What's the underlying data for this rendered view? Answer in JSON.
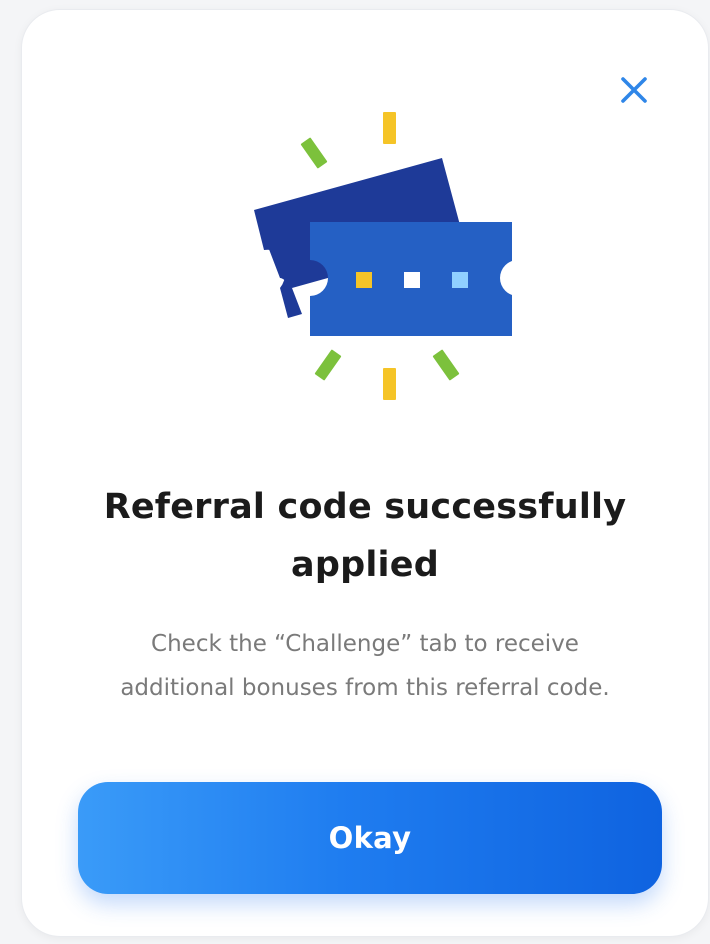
{
  "dialog": {
    "close_icon": "close-icon",
    "illustration_icon": "tickets-icon",
    "title": "Referral code successfully applied",
    "description": "Check the “Challenge” tab to receive additional bonuses from this referral code.",
    "okay_label": "Okay"
  },
  "colors": {
    "accent": "#1f7df0",
    "close": "#2f86e8",
    "ticket_back": "#1e3a98",
    "ticket_front": "#2560c4",
    "confetti_green": "#7cc13c",
    "confetti_yellow": "#f5c427",
    "dot_light_blue": "#8fd0ff"
  }
}
